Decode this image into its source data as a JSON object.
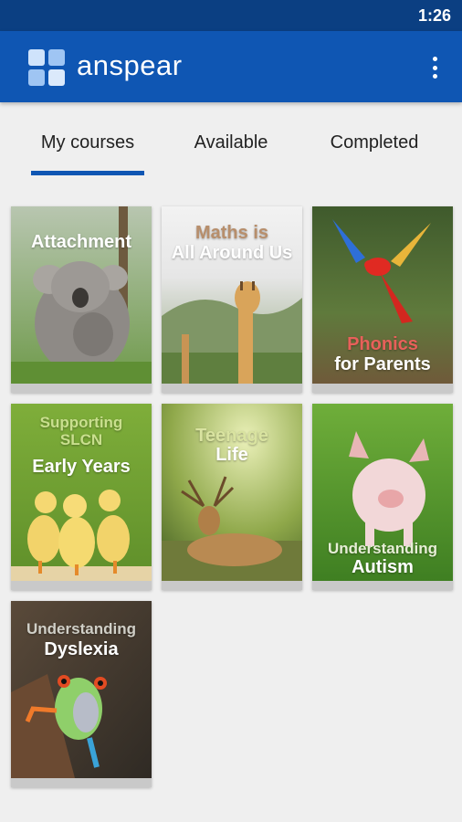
{
  "status_bar": {
    "time": "1:26"
  },
  "app_bar": {
    "brand": "anspear",
    "menu_icon": "more-vert-icon"
  },
  "tabs": [
    {
      "label": "My courses",
      "selected": true
    },
    {
      "label": "Available",
      "selected": false
    },
    {
      "label": "Completed",
      "selected": false
    }
  ],
  "courses": [
    {
      "line1": "Attachment",
      "line2": ""
    },
    {
      "line1": "Maths is",
      "line2": "All Around Us"
    },
    {
      "line1": "Phonics",
      "line2": "for Parents"
    },
    {
      "line1": "Supporting",
      "line2": "SLCN",
      "line3": "Early Years"
    },
    {
      "line1": "Teenage",
      "line2": "Life"
    },
    {
      "line1": "Understanding",
      "line2": "Autism"
    },
    {
      "line1": "Understanding",
      "line2": "Dyslexia"
    }
  ],
  "colors": {
    "status_bar": "#0b3f82",
    "app_bar": "#0f56b3",
    "accent": "#0f56b3"
  }
}
